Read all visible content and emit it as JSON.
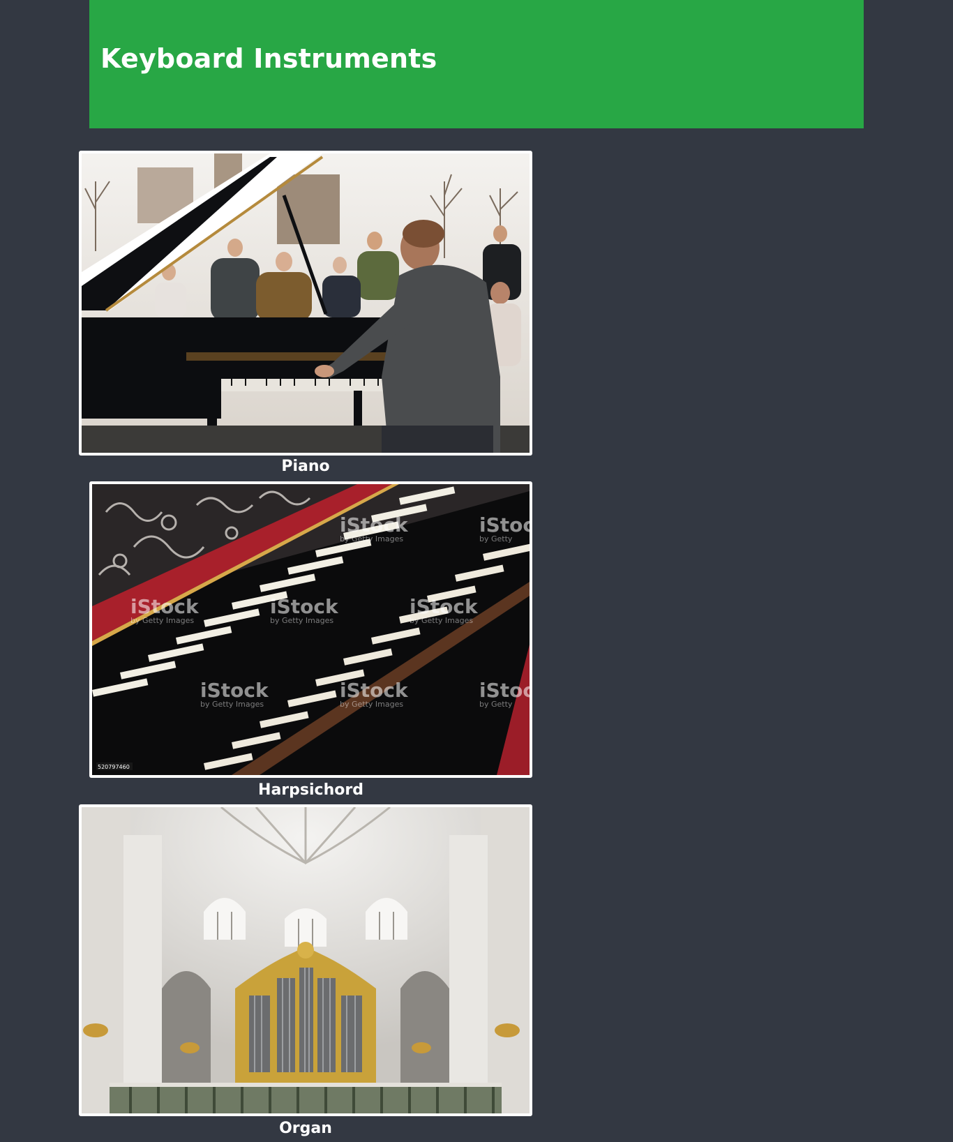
{
  "page": {
    "title": "Keyboard Instruments",
    "header_color": "#28a745",
    "background_color": "#333842"
  },
  "instruments": [
    {
      "name": "Piano",
      "image": "piano-photo"
    },
    {
      "name": "Harpsichord",
      "image": "harpsichord-photo",
      "watermark": "iStock",
      "watermark_sub": "by Getty Images",
      "stock_id": "520797460"
    },
    {
      "name": "Organ",
      "image": "organ-photo"
    }
  ]
}
